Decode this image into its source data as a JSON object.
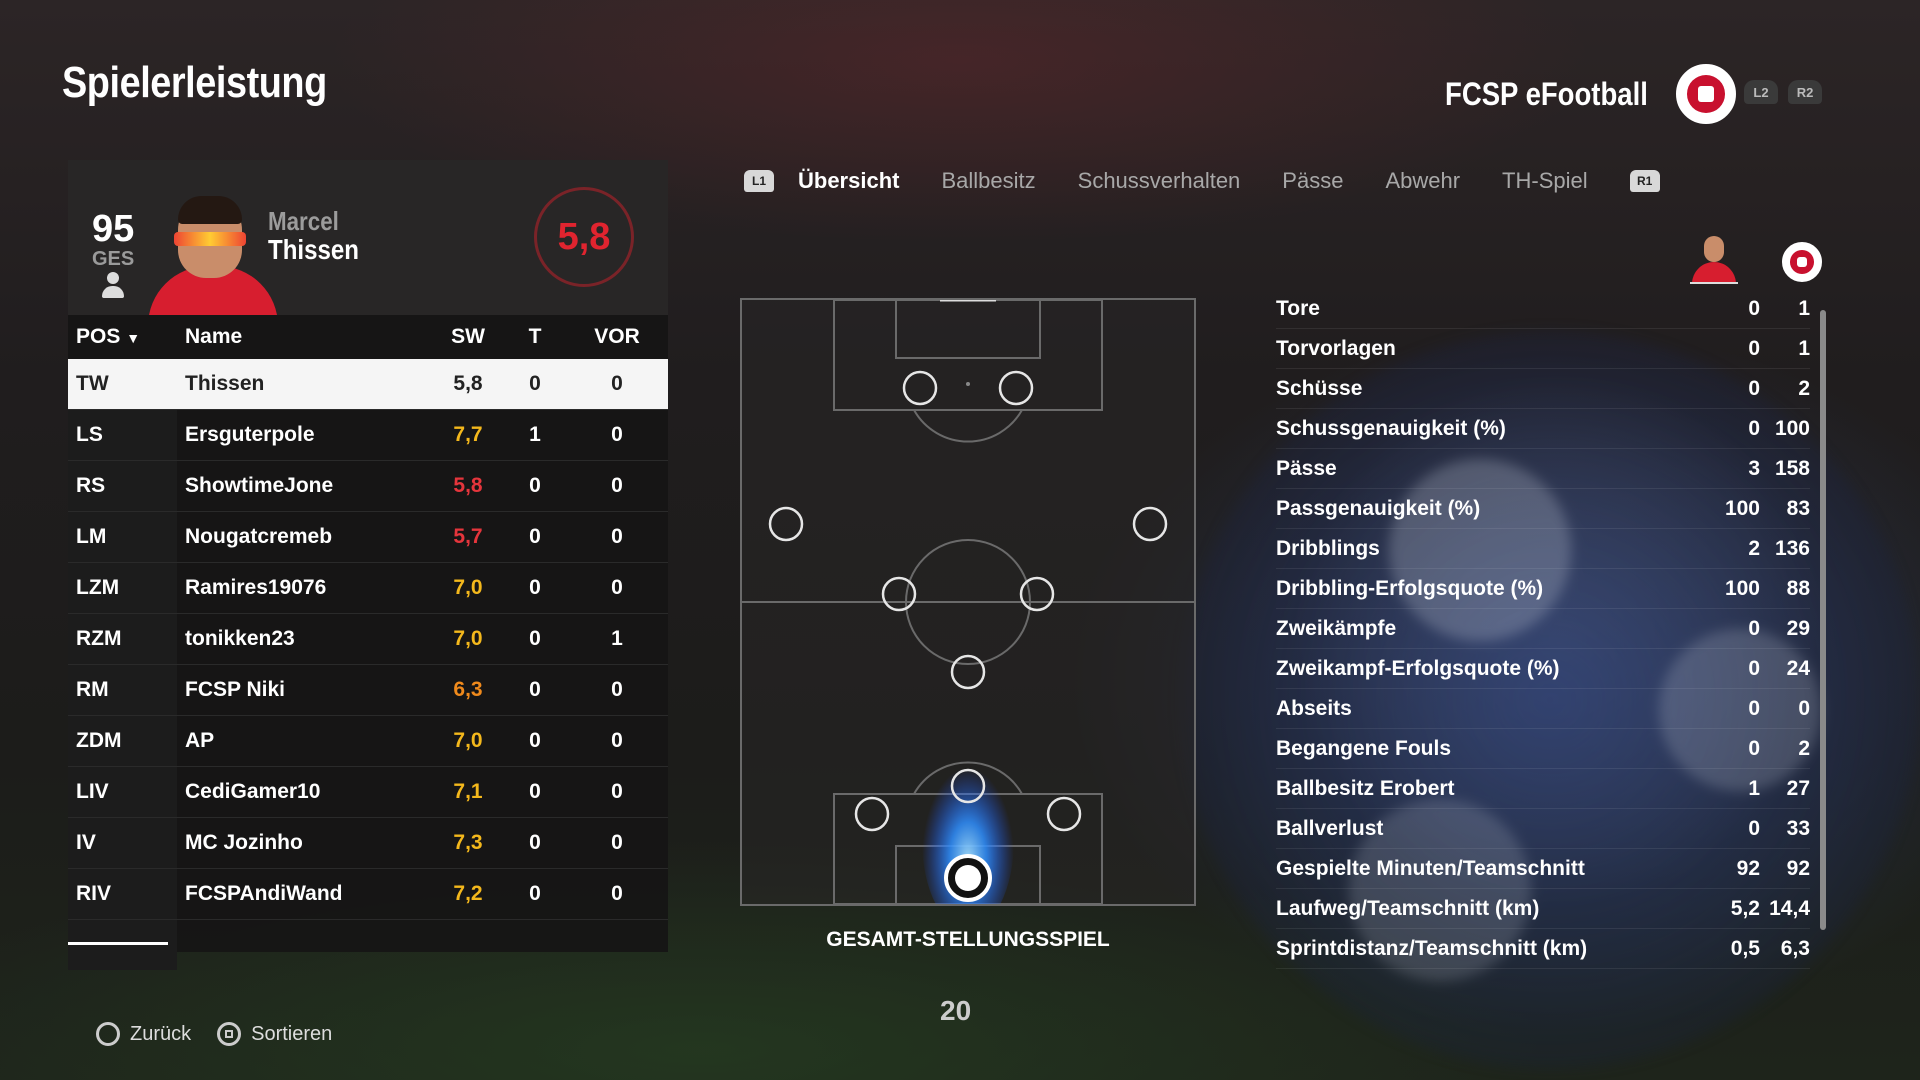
{
  "header": {
    "title": "Spielerleistung",
    "team_name": "FCSP eFootball",
    "l2": "L2",
    "r2": "R2"
  },
  "player_card": {
    "ges_value": "95",
    "ges_label": "GES",
    "first_name": "Marcel",
    "last_name": "Thissen",
    "rating": "5,8"
  },
  "table": {
    "headers": {
      "pos": "POS",
      "name": "Name",
      "sw": "SW",
      "t": "T",
      "vor": "VOR"
    },
    "rows": [
      {
        "pos": "TW",
        "name": "Thissen",
        "sw": "5,8",
        "t": "0",
        "vor": "0",
        "selected": true
      },
      {
        "pos": "LS",
        "name": "Ersguterpole",
        "sw": "7,7",
        "t": "1",
        "vor": "0",
        "rating_color": "high"
      },
      {
        "pos": "RS",
        "name": "ShowtimeJone",
        "sw": "5,8",
        "t": "0",
        "vor": "0",
        "rating_color": "low"
      },
      {
        "pos": "LM",
        "name": "Nougatcremeb",
        "sw": "5,7",
        "t": "0",
        "vor": "0",
        "rating_color": "low"
      },
      {
        "pos": "LZM",
        "name": "Ramires19076",
        "sw": "7,0",
        "t": "0",
        "vor": "0",
        "rating_color": "high"
      },
      {
        "pos": "RZM",
        "name": "tonikken23",
        "sw": "7,0",
        "t": "0",
        "vor": "1",
        "rating_color": "high"
      },
      {
        "pos": "RM",
        "name": "FCSP Niki",
        "sw": "6,3",
        "t": "0",
        "vor": "0",
        "rating_color": "mid"
      },
      {
        "pos": "ZDM",
        "name": "AP",
        "sw": "7,0",
        "t": "0",
        "vor": "0",
        "rating_color": "high"
      },
      {
        "pos": "LIV",
        "name": "CediGamer10",
        "sw": "7,1",
        "t": "0",
        "vor": "0",
        "rating_color": "high"
      },
      {
        "pos": "IV",
        "name": "MC Jozinho",
        "sw": "7,3",
        "t": "0",
        "vor": "0",
        "rating_color": "high"
      },
      {
        "pos": "RIV",
        "name": "FCSPAndiWand",
        "sw": "7,2",
        "t": "0",
        "vor": "0",
        "rating_color": "high"
      }
    ]
  },
  "tabs": {
    "l1": "L1",
    "r1": "R1",
    "items": [
      "Übersicht",
      "Ballbesitz",
      "Schussverhalten",
      "Pässe",
      "Abwehr",
      "TH-Spiel"
    ],
    "active": "Übersicht"
  },
  "pitch": {
    "caption": "GESAMT-STELLUNGSSPIEL"
  },
  "page_number": "20",
  "stats": [
    {
      "label": "Tore",
      "player": "0",
      "team": "1"
    },
    {
      "label": "Torvorlagen",
      "player": "0",
      "team": "1"
    },
    {
      "label": "Schüsse",
      "player": "0",
      "team": "2"
    },
    {
      "label": "Schussgenauigkeit (%)",
      "player": "0",
      "team": "100"
    },
    {
      "label": "Pässe",
      "player": "3",
      "team": "158"
    },
    {
      "label": "Passgenauigkeit (%)",
      "player": "100",
      "team": "83"
    },
    {
      "label": "Dribblings",
      "player": "2",
      "team": "136"
    },
    {
      "label": "Dribbling-Erfolgsquote (%)",
      "player": "100",
      "team": "88"
    },
    {
      "label": "Zweikämpfe",
      "player": "0",
      "team": "29"
    },
    {
      "label": "Zweikampf-Erfolgsquote (%)",
      "player": "0",
      "team": "24"
    },
    {
      "label": "Abseits",
      "player": "0",
      "team": "0"
    },
    {
      "label": "Begangene Fouls",
      "player": "0",
      "team": "2"
    },
    {
      "label": "Ballbesitz Erobert",
      "player": "1",
      "team": "27"
    },
    {
      "label": "Ballverlust",
      "player": "0",
      "team": "33"
    },
    {
      "label": "Gespielte Minuten/Teamschnitt",
      "player": "92",
      "team": "92"
    },
    {
      "label": "Laufweg/Teamschnitt (km)",
      "player": "5,2",
      "team": "14,4"
    },
    {
      "label": "Sprintdistanz/Teamschnitt (km)",
      "player": "0,5",
      "team": "6,3"
    }
  ],
  "footer": {
    "back": "Zurück",
    "sort": "Sortieren"
  },
  "colors": {
    "rating_low": "#e5353c",
    "rating_mid": "#f08a1c",
    "rating_high": "#f4b81c",
    "club_red": "#c8102e"
  }
}
